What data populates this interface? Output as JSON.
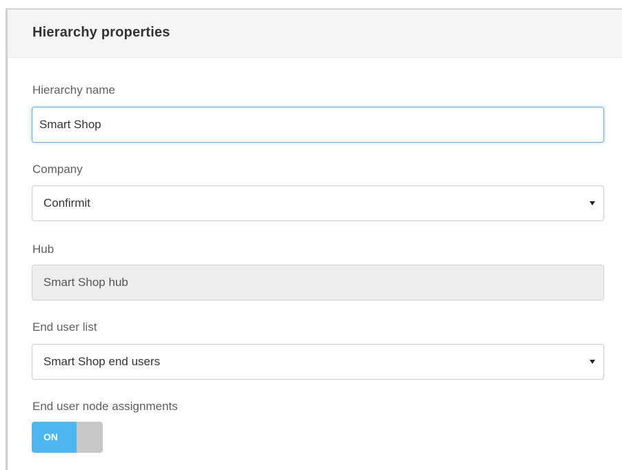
{
  "panel": {
    "title": "Hierarchy properties"
  },
  "fields": {
    "hierarchy_name": {
      "label": "Hierarchy name",
      "value": "Smart Shop"
    },
    "company": {
      "label": "Company",
      "selected": "Confirmit"
    },
    "hub": {
      "label": "Hub",
      "value": "Smart Shop hub"
    },
    "end_user_list": {
      "label": "End user list",
      "selected": "Smart Shop end users"
    },
    "end_user_node_assignments": {
      "label": "End user node assignments",
      "toggle_text": "ON",
      "state": "on"
    }
  },
  "icons": {
    "dropdown": "caret-down-icon"
  },
  "colors": {
    "toggle_on": "#4cb6ef",
    "toggle_off": "#c6c7c9",
    "focus_border": "#66afe9",
    "readonly_bg": "#eeeeee"
  }
}
